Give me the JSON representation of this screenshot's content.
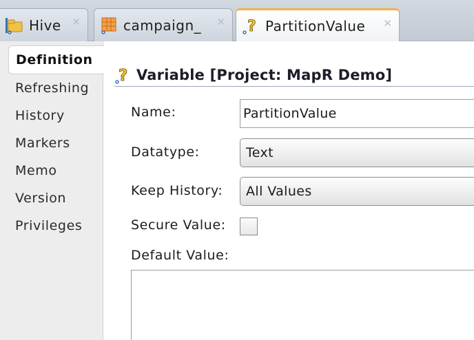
{
  "tabs": [
    {
      "label": "Hive",
      "icon": "hive-folder-icon",
      "active": false
    },
    {
      "label": "campaign_",
      "icon": "datastore-table-icon",
      "active": false
    },
    {
      "label": "PartitionValue",
      "icon": "variable-question-icon",
      "active": true
    }
  ],
  "tab_close_glyph": "✕",
  "nav": {
    "items": [
      {
        "label": "Definition",
        "active": true
      },
      {
        "label": "Refreshing"
      },
      {
        "label": "History"
      },
      {
        "label": "Markers"
      },
      {
        "label": "Memo"
      },
      {
        "label": "Version"
      },
      {
        "label": "Privileges"
      }
    ]
  },
  "section": {
    "title": "Variable [Project: MapR Demo]",
    "icon": "variable-question-icon"
  },
  "form": {
    "name_label": "Name:",
    "name_value": "PartitionValue",
    "datatype_label": "Datatype:",
    "datatype_value": "Text",
    "keep_history_label": "Keep History:",
    "keep_history_value": "All Values",
    "secure_value_label": "Secure Value:",
    "secure_value_checked": false,
    "default_value_label": "Default Value:",
    "default_value": ""
  },
  "colors": {
    "active_tab_accent": "#f2b14a",
    "tabbar_bg": "#c9d0d9",
    "nav_bg": "#ededed",
    "header_rule": "#9aa6b5"
  }
}
